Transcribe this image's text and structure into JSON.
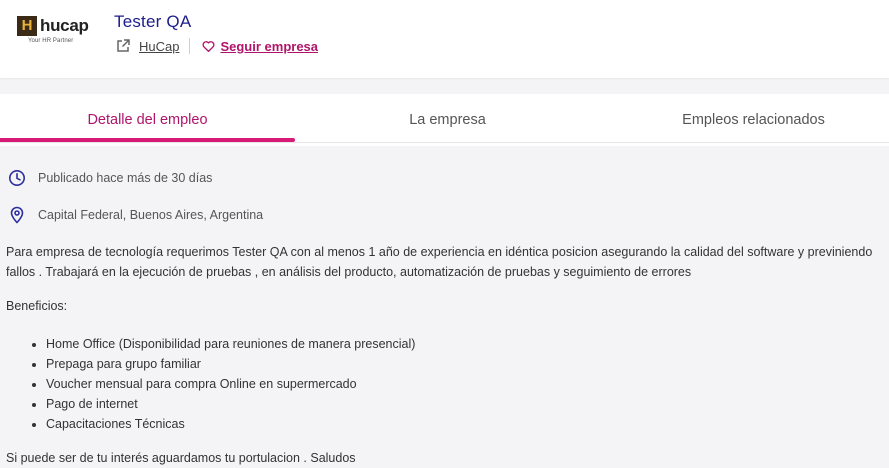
{
  "header": {
    "logo_word": "hucap",
    "logo_tagline": "Your HR Partner",
    "job_title": "Tester QA",
    "company_name": "HuCap",
    "follow_label": "Seguir empresa"
  },
  "tabs": [
    {
      "label": "Detalle del empleo",
      "active": true
    },
    {
      "label": "La empresa",
      "active": false
    },
    {
      "label": "Empleos relacionados",
      "active": false
    }
  ],
  "details": {
    "published": "Publicado hace más de 30 días",
    "location": "Capital Federal, Buenos Aires, Argentina",
    "description": "Para empresa de tecnología requerimos Tester QA con al menos 1 año de experiencia en idéntica posicion asegurando la calidad del software y previniendo fallos . Trabajará en la ejecución de pruebas , en análisis del producto, automatización de pruebas y seguimiento de errores",
    "benefits_title": "Beneficios:",
    "benefits": [
      "Home Office (Disponibilidad para reuniones de manera presencial)",
      "Prepaga para grupo familiar",
      "Voucher mensual para compra Online en supermercado",
      "Pago de internet",
      "Capacitaciones Técnicas"
    ],
    "closing": "Si puede ser de tu interés aguardamos tu portulacion . Saludos"
  },
  "colors": {
    "title": "#1c1d8c",
    "accent": "#b0146a",
    "tab_underline": "#d81b77",
    "icon_blue": "#2d2f9c"
  },
  "icons": {
    "external": "external-link-icon",
    "follow": "heart-icon",
    "published": "clock-icon",
    "location": "location-pin-icon"
  }
}
